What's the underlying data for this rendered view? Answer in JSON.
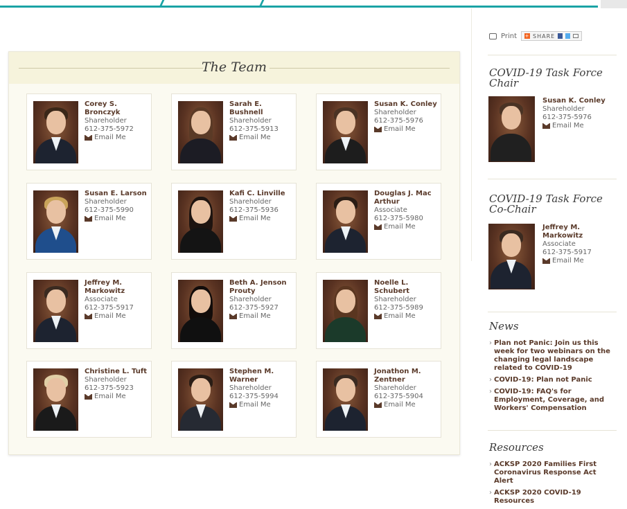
{
  "team": {
    "title": "The Team",
    "email_label": "Email Me",
    "members": [
      {
        "name": "Corey S. Bronczyk",
        "title": "Shareholder",
        "phone": "612-375-5972"
      },
      {
        "name": "Sarah E. Bushnell",
        "title": "Shareholder",
        "phone": "612-375-5913"
      },
      {
        "name": "Susan K. Conley",
        "title": "Shareholder",
        "phone": "612-375-5976"
      },
      {
        "name": "Susan E. Larson",
        "title": "Shareholder",
        "phone": "612-375-5990"
      },
      {
        "name": "Kafi C. Linville",
        "title": "Shareholder",
        "phone": "612-375-5936"
      },
      {
        "name": "Douglas J. Mac Arthur",
        "title": "Associate",
        "phone": "612-375-5980"
      },
      {
        "name": "Jeffrey M. Markowitz",
        "title": "Associate",
        "phone": "612-375-5917"
      },
      {
        "name": "Beth A. Jenson Prouty",
        "title": "Shareholder",
        "phone": "612-375-5927"
      },
      {
        "name": "Noelle L. Schubert",
        "title": "Shareholder",
        "phone": "612-375-5989"
      },
      {
        "name": "Christine L. Tuft",
        "title": "Shareholder",
        "phone": "612-375-5923"
      },
      {
        "name": "Stephen M. Warner",
        "title": "Shareholder",
        "phone": "612-375-5994"
      },
      {
        "name": "Jonathon M. Zentner",
        "title": "Shareholder",
        "phone": "612-375-5904"
      }
    ]
  },
  "sidebar": {
    "print_label": "Print",
    "share_label": "SHARE",
    "chair": {
      "heading": "COVID-19 Task Force Chair",
      "name": "Susan K. Conley",
      "title": "Shareholder",
      "phone": "612-375-5976",
      "email_label": "Email Me"
    },
    "cochair": {
      "heading": "COVID-19 Task Force Co-Chair",
      "name": "Jeffrey M. Markowitz",
      "title": "Associate",
      "phone": "612-375-5917",
      "email_label": "Email Me"
    },
    "news": {
      "heading": "News",
      "items": [
        "Plan not Panic: Join us this week for two webinars on the changing legal landscape related to COVID-19",
        "COVID-19: Plan not Panic",
        "COVID-19: FAQ's for Employment, Coverage, and Workers' Compensation"
      ]
    },
    "resources": {
      "heading": "Resources",
      "items": [
        "ACKSP 2020 Families First Coronavirus Response Act Alert",
        "ACKSP 2020 COVID-19 Resources"
      ]
    }
  },
  "colors": {
    "accent_teal": "#1aa3a5",
    "name_brown": "#5a3a2a",
    "panel_header": "#f6f3dc"
  }
}
